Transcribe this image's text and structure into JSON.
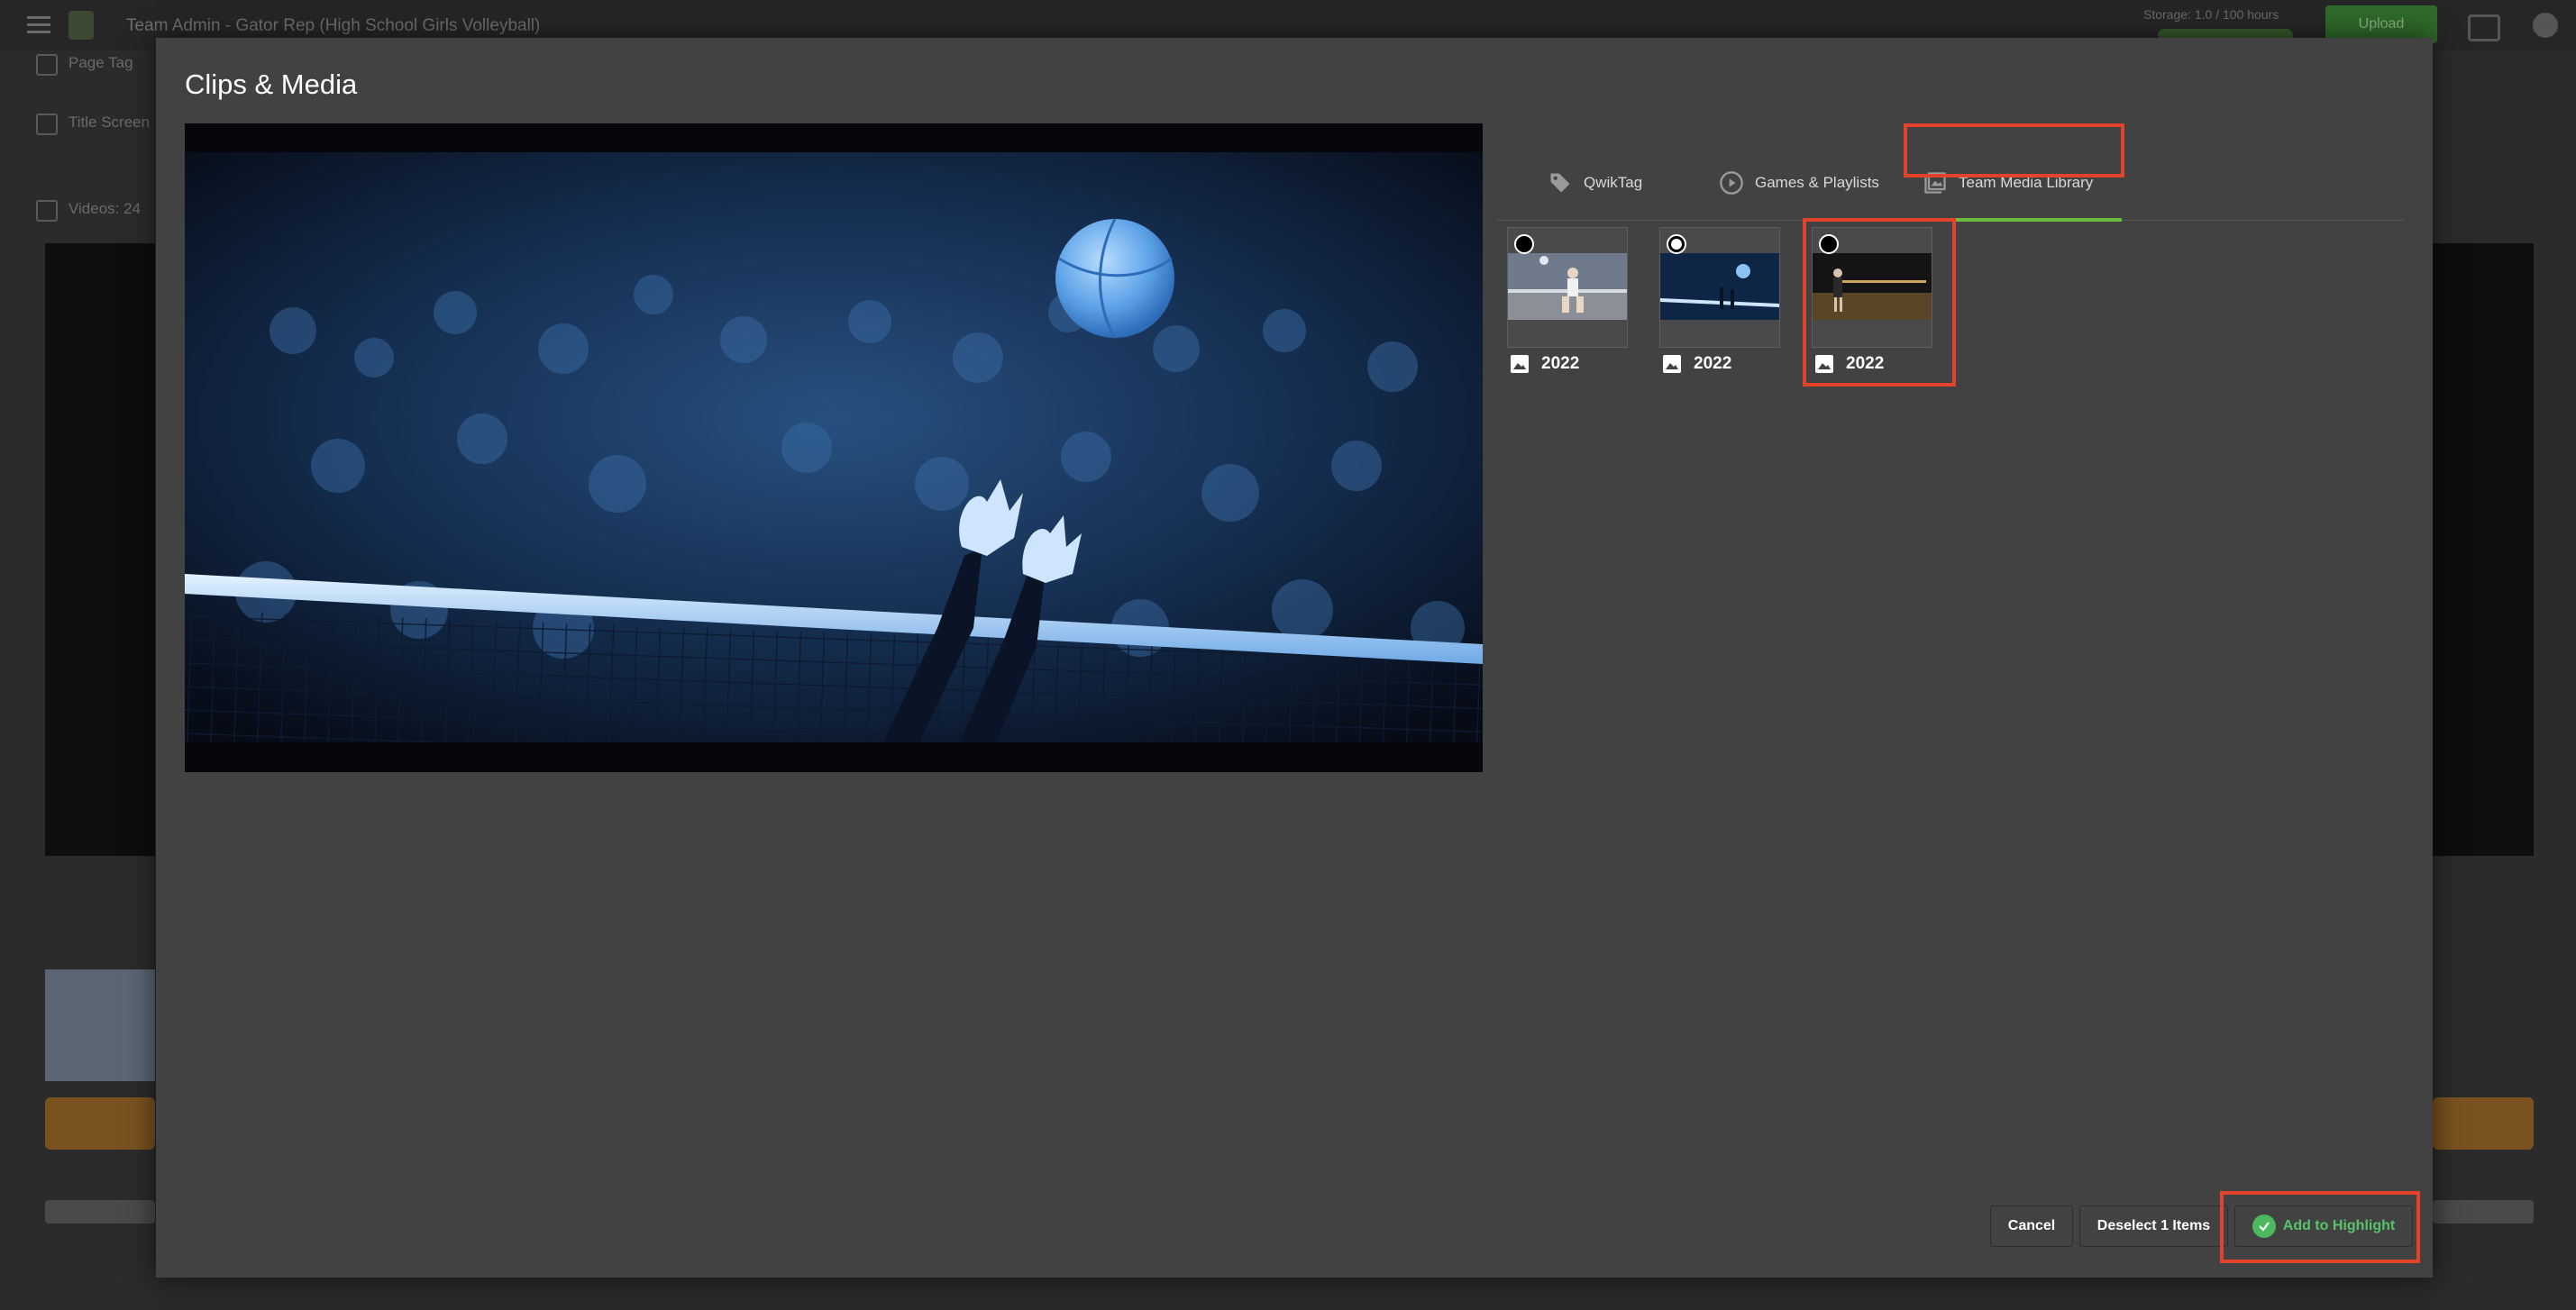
{
  "app": {
    "title": "Team Admin - Gator Rep (High School Girls Volleyball)",
    "storage_text": "Storage: 1.0 / 100 hours",
    "upload_label": "Upload"
  },
  "background": {
    "rows": [
      "Page Tag",
      "Title Screen",
      "Videos: 24"
    ]
  },
  "modal": {
    "title": "Clips & Media",
    "tabs": [
      {
        "label": "QwikTag",
        "icon": "tag-icon",
        "active": false
      },
      {
        "label": "Games & Playlists",
        "icon": "play-circle-icon",
        "active": false
      },
      {
        "label": "Team Media Library",
        "icon": "photo-library-icon",
        "active": true
      }
    ],
    "media": [
      {
        "caption": "2022",
        "selected": false,
        "icon": "image-icon"
      },
      {
        "caption": "2022",
        "selected": true,
        "icon": "image-icon"
      },
      {
        "caption": "2022",
        "selected": false,
        "icon": "image-icon"
      }
    ],
    "buttons": {
      "cancel": "Cancel",
      "deselect": "Deselect 1 Items",
      "add": "Add to Highlight"
    }
  },
  "colors": {
    "accent_green": "#6fbd3f",
    "highlight_red": "#e3432b",
    "modal_bg": "#424242"
  }
}
